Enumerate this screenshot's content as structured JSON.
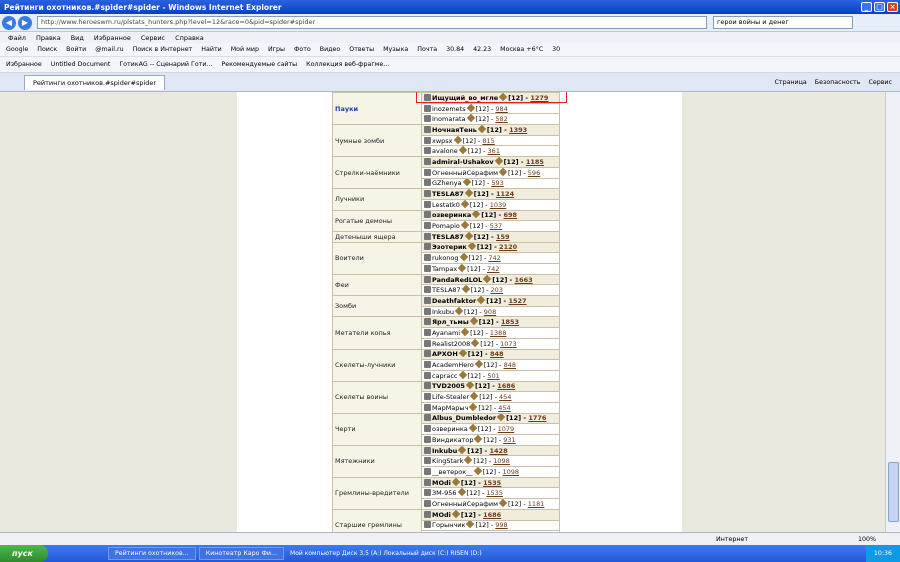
{
  "window": {
    "title": "Рейтинги охотников.#spider#spider - Windows Internet Explorer"
  },
  "address": {
    "url": "http://www.heroeswm.ru/plstats_hunters.php?level=12&race=0&pid=spider#spider",
    "search": "герои войны и денег"
  },
  "menu": [
    "Файл",
    "Правка",
    "Вид",
    "Избранное",
    "Сервис",
    "Справка"
  ],
  "toolbar1": [
    "Google",
    "Поиск",
    "Войти",
    "@mail.ru",
    "Поиск в Интернет",
    "Найти",
    "Мой мир",
    "Игры",
    "Фото",
    "Видео",
    "Ответы",
    "Музыка",
    "Почта",
    "30.84",
    "42.23",
    "Москва +6°C",
    "30"
  ],
  "toolbar2": [
    "Избранное",
    "Untitled Document",
    "ГотикАG -- Сценарий Готи...",
    "Рекомендуемые сайты",
    "Коллекция веб-фрагме..."
  ],
  "tab": {
    "label": "Рейтинги охотников.#spider#spider"
  },
  "tabtools": [
    "Страница",
    "Безопасность",
    "Сервис"
  ],
  "rows": [
    {
      "cat": "Пауки",
      "sel": true,
      "players": [
        {
          "name": "Ищущий_во_мгле",
          "lvl": "[12]",
          "score": "1279",
          "bold": true
        },
        {
          "name": "inozemets",
          "lvl": "[12]",
          "score": "984"
        },
        {
          "name": "Inomarata",
          "lvl": "[12]",
          "score": "582"
        }
      ]
    },
    {
      "cat": "Чумные зомби",
      "players": [
        {
          "name": "НочнаяТень",
          "lvl": "[12]",
          "score": "1393",
          "bold": true
        },
        {
          "name": "xwpsx",
          "lvl": "[12]",
          "score": "815"
        },
        {
          "name": "avalone",
          "lvl": "[12]",
          "score": "361"
        }
      ]
    },
    {
      "cat": "Стрелки-наёмники",
      "players": [
        {
          "name": "admiral-Ushakov",
          "lvl": "[12]",
          "score": "1185",
          "bold": true
        },
        {
          "name": "ОгненныйСерафим",
          "lvl": "[12]",
          "score": "596"
        },
        {
          "name": "GZhenya",
          "lvl": "[12]",
          "score": "593"
        }
      ]
    },
    {
      "cat": "Лучники",
      "players": [
        {
          "name": "TESLA87",
          "lvl": "[12]",
          "score": "1124",
          "bold": true
        },
        {
          "name": "Lestatk0",
          "lvl": "[12]",
          "score": "1039"
        }
      ]
    },
    {
      "cat": "Рогатые демоны",
      "players": [
        {
          "name": "озверинка",
          "lvl": "[12]",
          "score": "698",
          "bold": true
        },
        {
          "name": "Pomapio",
          "lvl": "[12]",
          "score": "537"
        }
      ]
    },
    {
      "cat": "Детеныши ящера",
      "players": [
        {
          "name": "TESLA87",
          "lvl": "[12]",
          "score": "159",
          "bold": true
        }
      ]
    },
    {
      "cat": "Воители",
      "players": [
        {
          "name": "Эзотерик",
          "lvl": "[12]",
          "score": "2120",
          "bold": true
        },
        {
          "name": "rukonog",
          "lvl": "[12]",
          "score": "742"
        },
        {
          "name": "Tampax",
          "lvl": "[12]",
          "score": "742"
        }
      ]
    },
    {
      "cat": "Феи",
      "players": [
        {
          "name": "PandaRedLOL",
          "lvl": "[12]",
          "score": "1663",
          "bold": true
        },
        {
          "name": "TESLA87",
          "lvl": "[12]",
          "score": "203"
        }
      ]
    },
    {
      "cat": "Зомби",
      "players": [
        {
          "name": "Deathfaktor",
          "lvl": "[12]",
          "score": "1527",
          "bold": true
        },
        {
          "name": "Inkubu",
          "lvl": "[12]",
          "score": "908"
        }
      ]
    },
    {
      "cat": "Метатели копья",
      "players": [
        {
          "name": "Ярл_тьмы",
          "lvl": "[12]",
          "score": "1853",
          "bold": true
        },
        {
          "name": "Ayanami",
          "lvl": "[12]",
          "score": "1388"
        },
        {
          "name": "Realist2008",
          "lvl": "[12]",
          "score": "1073"
        }
      ]
    },
    {
      "cat": "Скелеты-лучники",
      "players": [
        {
          "name": "АРХОН",
          "lvl": "[12]",
          "score": "848",
          "bold": true
        },
        {
          "name": "AcademHero",
          "lvl": "[12]",
          "score": "848"
        },
        {
          "name": "capracc",
          "lvl": "[12]",
          "score": "501"
        }
      ]
    },
    {
      "cat": "Скелеты воины",
      "players": [
        {
          "name": "TVD2005",
          "lvl": "[12]",
          "score": "1686",
          "bold": true
        },
        {
          "name": "Life-Stealer",
          "lvl": "[12]",
          "score": "454"
        },
        {
          "name": "МарМарыч",
          "lvl": "[12]",
          "score": "454"
        }
      ]
    },
    {
      "cat": "Черти",
      "players": [
        {
          "name": "Albus_Dumbledor",
          "lvl": "[12]",
          "score": "1776",
          "bold": true
        },
        {
          "name": "озверинка",
          "lvl": "[12]",
          "score": "1079"
        },
        {
          "name": "Виндикатор",
          "lvl": "[12]",
          "score": "931"
        }
      ]
    },
    {
      "cat": "Мятежники",
      "players": [
        {
          "name": "Inkubu",
          "lvl": "[12]",
          "score": "1428",
          "bold": true
        },
        {
          "name": "KingStark",
          "lvl": "[12]",
          "score": "1098"
        },
        {
          "name": "__ветерок__",
          "lvl": "[12]",
          "score": "1098"
        }
      ]
    },
    {
      "cat": "Гремлины-вредители",
      "players": [
        {
          "name": "MOdi",
          "lvl": "[12]",
          "score": "1535",
          "bold": true
        },
        {
          "name": "ЗМ-956",
          "lvl": "[12]",
          "score": "1535"
        },
        {
          "name": "ОгненныйСерафим",
          "lvl": "[12]",
          "score": "1181"
        }
      ]
    },
    {
      "cat": "Старшие гремлины",
      "players": [
        {
          "name": "MOdi",
          "lvl": "[12]",
          "score": "1686",
          "bold": true
        },
        {
          "name": "Горынчик",
          "lvl": "[12]",
          "score": "998"
        },
        {
          "name": "",
          "lvl": "",
          "score": ""
        }
      ]
    }
  ],
  "status": {
    "internet": "Интернет",
    "zoom": "100%"
  },
  "taskbar": {
    "start": "пуск",
    "buttons": [
      "Рейтинги охотников...",
      "Кинотеатр Каро Фи..."
    ],
    "hints": "Мой компьютер  Диск 3,5 (A:)  Локальный диск (C:)  RISEN (D:)",
    "clock": "10:36"
  }
}
